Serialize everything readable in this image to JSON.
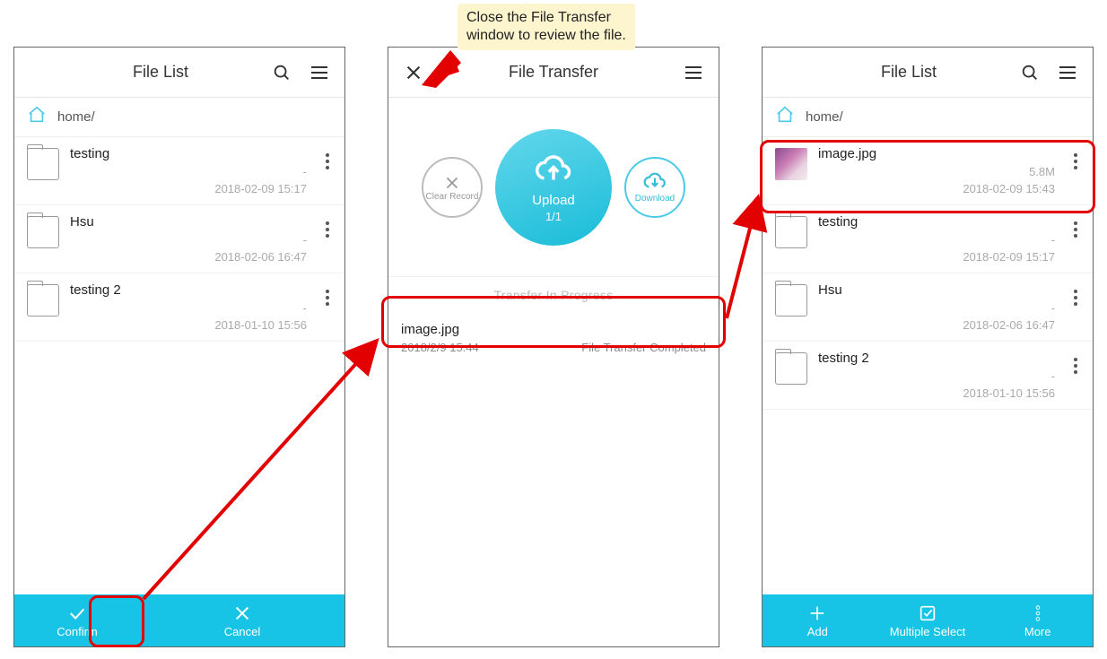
{
  "annotation": {
    "l1": "Close the File Transfer",
    "l2": "window to review the file."
  },
  "screen1": {
    "title": "File List",
    "path": "home/",
    "items": [
      {
        "name": "testing",
        "size": "-",
        "date": "2018-02-09 15:17"
      },
      {
        "name": "Hsu",
        "size": "-",
        "date": "2018-02-06 16:47"
      },
      {
        "name": "testing 2",
        "size": "-",
        "date": "2018-01-10 15:56"
      }
    ],
    "confirm": "Confirm",
    "cancel": "Cancel"
  },
  "screen2": {
    "title": "File Transfer",
    "upload_label": "Upload",
    "upload_count": "1/1",
    "clear_label": "Clear Record",
    "download_label": "Download",
    "section": "Transfer In Progress",
    "item": {
      "name": "image.jpg",
      "time": "2018/2/9 15:44",
      "status": "File Transfer Completed"
    }
  },
  "screen3": {
    "title": "File List",
    "path": "home/",
    "items": [
      {
        "name": "image.jpg",
        "size": "5.8M",
        "date": "2018-02-09 15:43",
        "type": "image"
      },
      {
        "name": "testing",
        "size": "-",
        "date": "2018-02-09 15:17",
        "type": "folder"
      },
      {
        "name": "Hsu",
        "size": "-",
        "date": "2018-02-06 16:47",
        "type": "folder"
      },
      {
        "name": "testing 2",
        "size": "-",
        "date": "2018-01-10 15:56",
        "type": "folder"
      }
    ],
    "add": "Add",
    "multi": "Multiple Select",
    "more": "More"
  }
}
